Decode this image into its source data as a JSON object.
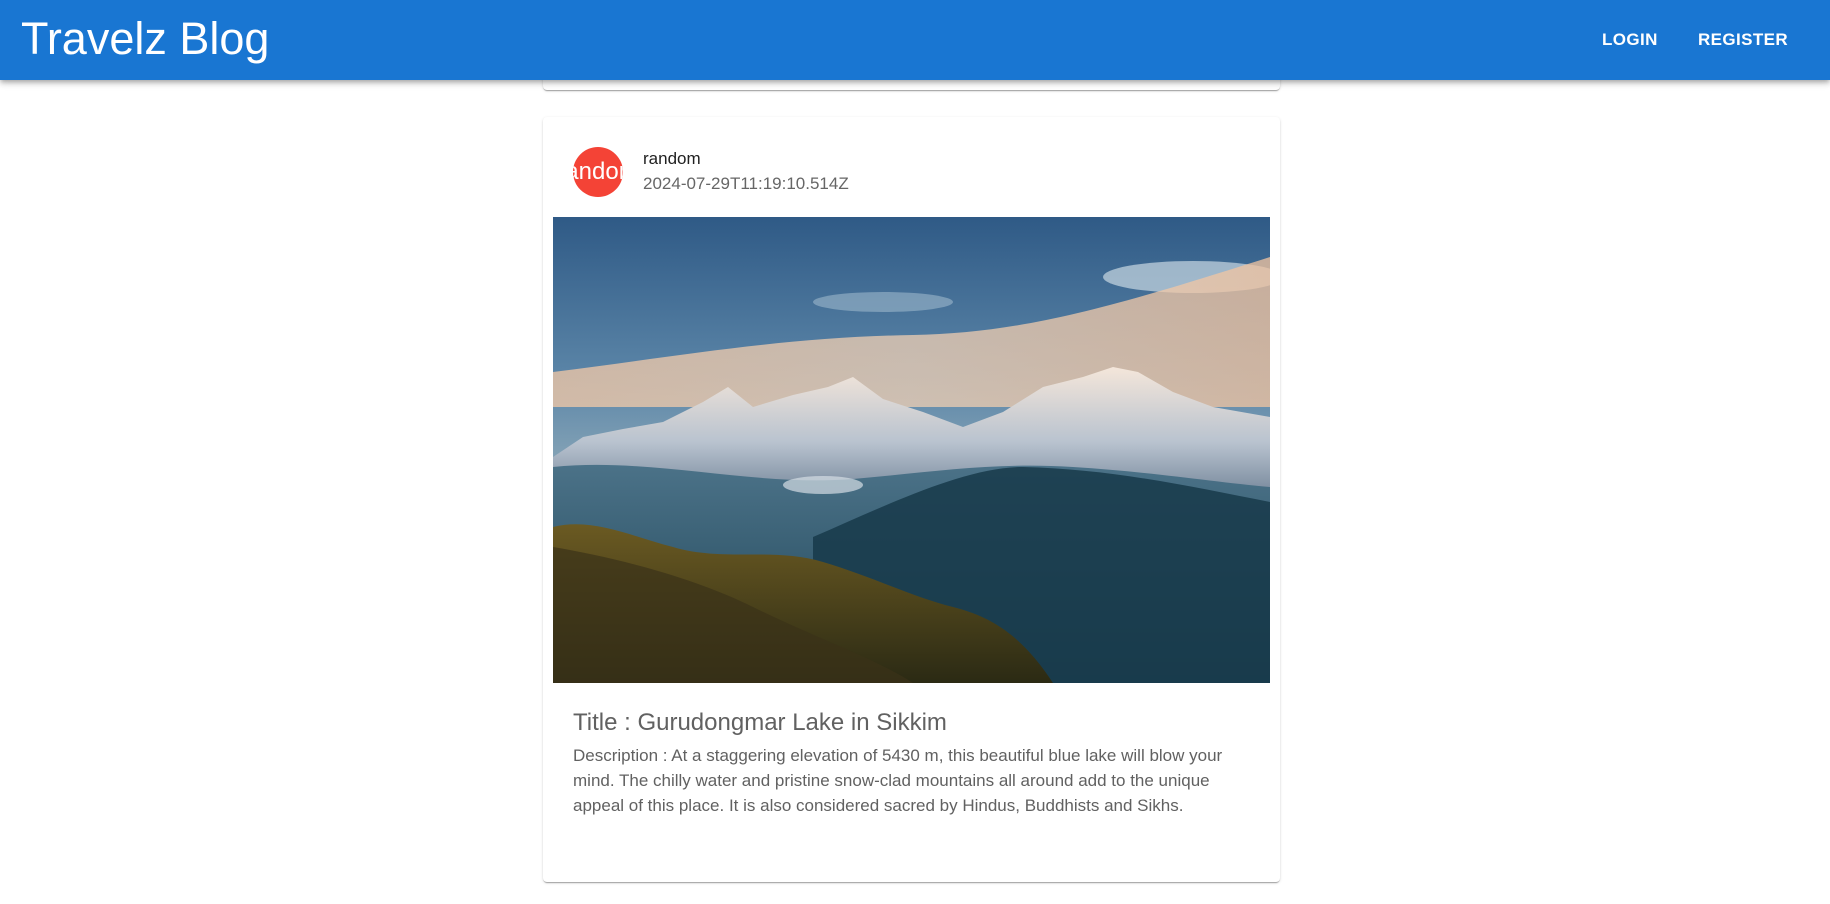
{
  "header": {
    "title": "Travelz Blog",
    "login_label": "LOGIN",
    "register_label": "REGISTER",
    "color": "#1976d2"
  },
  "post": {
    "avatar_text": "random",
    "avatar_color": "#f44336",
    "author": "random",
    "date": "2024-07-29T11:19:10.514Z",
    "image_alt": "mountains-image",
    "title": "Title : Gurudongmar Lake in Sikkim",
    "description": "Description : At a staggering elevation of 5430 m, this beautiful blue lake will blow your mind. The chilly water and pristine snow-clad mountains all around add to the unique appeal of this place. It is also considered sacred by Hindus, Buddhists and Sikhs."
  }
}
